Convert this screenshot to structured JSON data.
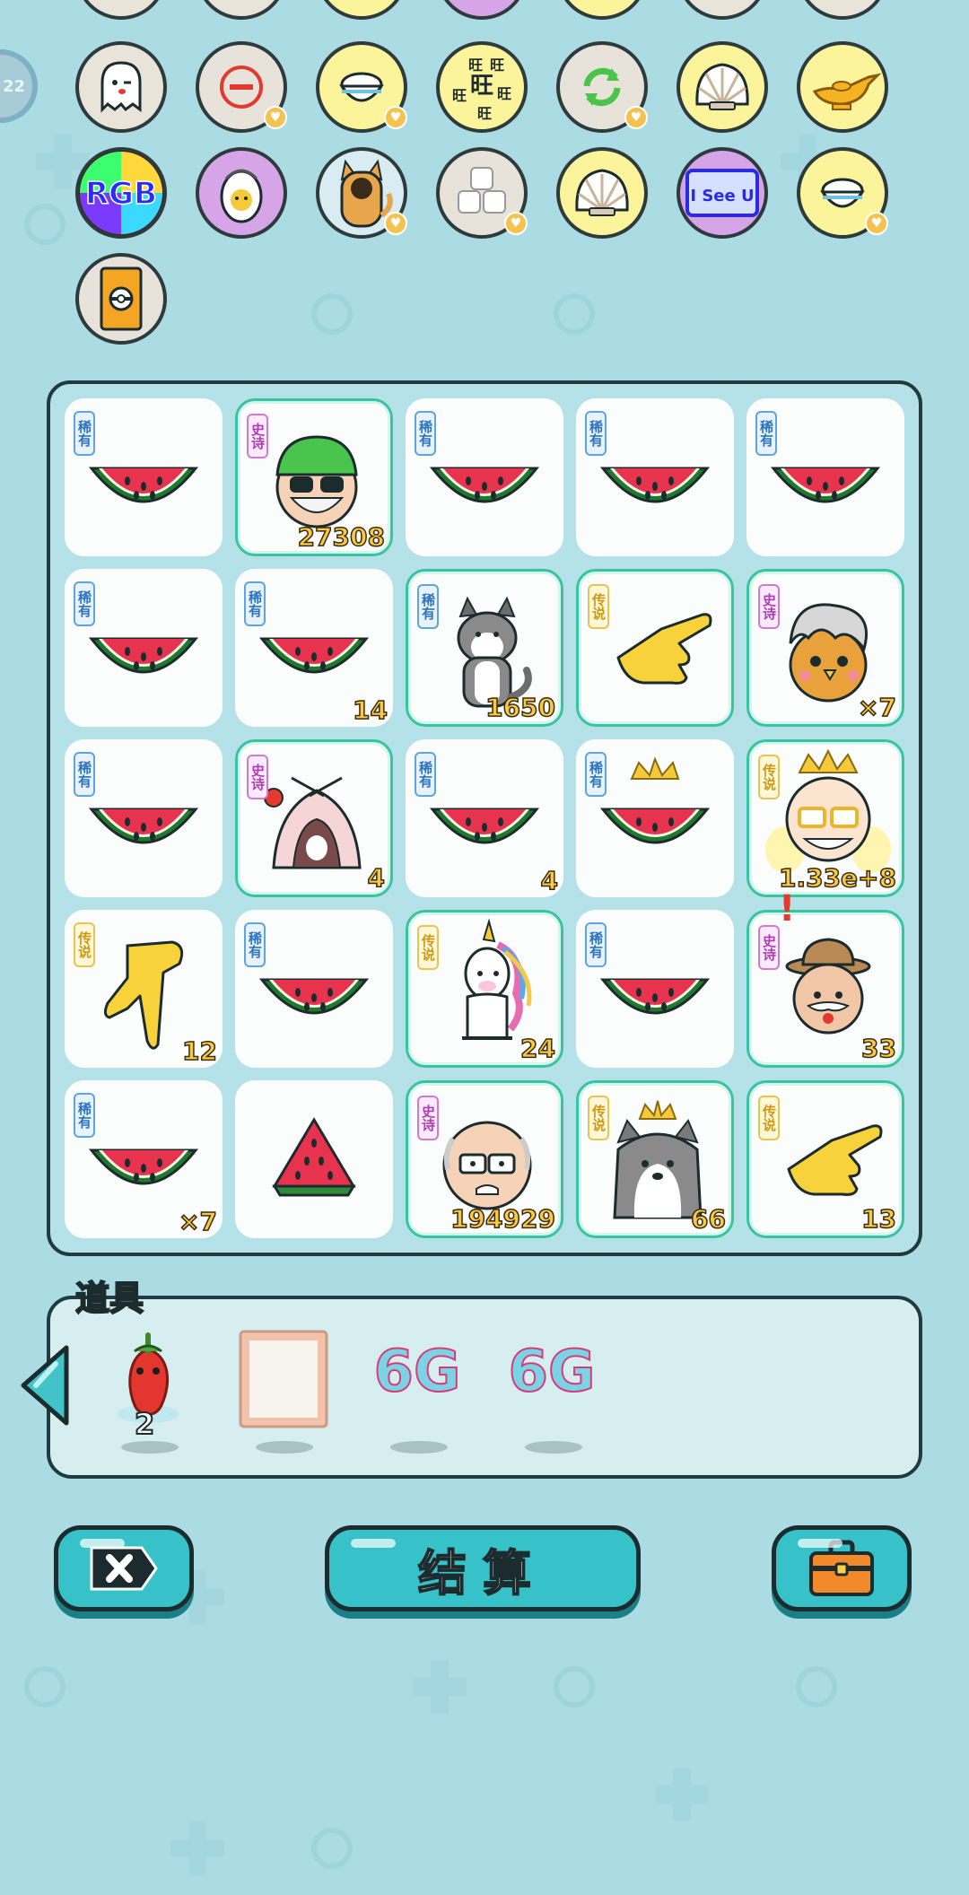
{
  "top_badges": {
    "level_text": "22",
    "row1": [
      {
        "name": "ghost",
        "bg": "#e9e4da"
      },
      {
        "name": "minus",
        "bg": "#e7e3da"
      },
      {
        "name": "rice-bowl",
        "bg": "#fbf49b"
      },
      {
        "name": "wang-text",
        "bg": "#fbf49b",
        "text": "旺"
      },
      {
        "name": "refresh",
        "bg": "#e7e3da"
      },
      {
        "name": "shell",
        "bg": "#fbf49b"
      },
      {
        "name": "magic-lamp",
        "bg": "#fbf49b"
      }
    ],
    "row2": [
      {
        "name": "rgb",
        "bg": "#2b2b2b",
        "text": "RGB"
      },
      {
        "name": "egg-face",
        "bg": "#d5a5e8"
      },
      {
        "name": "cat",
        "bg": "#d8ecf2"
      },
      {
        "name": "sugar-cubes",
        "bg": "#e7e3da"
      },
      {
        "name": "shell",
        "bg": "#fbf49b"
      },
      {
        "name": "i-see-u",
        "bg": "#d5a5e8",
        "text": "I See U"
      },
      {
        "name": "rice-bowl",
        "bg": "#fbf49b"
      }
    ],
    "row3": [
      {
        "name": "ticket",
        "bg": "#e7e3da"
      }
    ]
  },
  "grid": {
    "cells": [
      {
        "tag": "稀有",
        "tag_type": "rare",
        "item": "watermelon",
        "count": "",
        "hl": false
      },
      {
        "tag": "史诗",
        "tag_type": "epic",
        "item": "green-cap-man",
        "count": "27308",
        "hl": true
      },
      {
        "tag": "稀有",
        "tag_type": "rare",
        "item": "watermelon",
        "count": "",
        "hl": false
      },
      {
        "tag": "稀有",
        "tag_type": "rare",
        "item": "watermelon",
        "count": "",
        "hl": false
      },
      {
        "tag": "稀有",
        "tag_type": "rare",
        "item": "watermelon",
        "count": "",
        "hl": false
      },
      {
        "tag": "稀有",
        "tag_type": "rare",
        "item": "watermelon",
        "count": "",
        "hl": false
      },
      {
        "tag": "稀有",
        "tag_type": "rare",
        "item": "watermelon",
        "count": "14",
        "hl": false
      },
      {
        "tag": "稀有",
        "tag_type": "rare",
        "item": "husky",
        "count": "1650",
        "hl": true
      },
      {
        "tag": "传说",
        "tag_type": "legend",
        "item": "hand-point",
        "count": "",
        "hl": true
      },
      {
        "tag": "史诗",
        "tag_type": "epic",
        "item": "bird-grey-hair",
        "count": "×7",
        "hl": true
      },
      {
        "tag": "稀有",
        "tag_type": "rare",
        "item": "watermelon",
        "count": "",
        "hl": false
      },
      {
        "tag": "史诗",
        "tag_type": "epic",
        "item": "rabbit-tent",
        "count": "4",
        "hl": true
      },
      {
        "tag": "稀有",
        "tag_type": "rare",
        "item": "watermelon",
        "count": "4",
        "hl": false
      },
      {
        "tag": "稀有",
        "tag_type": "rare",
        "item": "watermelon-crown",
        "count": "",
        "hl": false
      },
      {
        "tag": "传说",
        "tag_type": "legend",
        "item": "king-grandpa",
        "count": "1.33e+8",
        "hl": true
      },
      {
        "tag": "传说",
        "tag_type": "legend",
        "item": "hand-down",
        "count": "12",
        "hl": false
      },
      {
        "tag": "稀有",
        "tag_type": "rare",
        "item": "watermelon",
        "count": "",
        "hl": false
      },
      {
        "tag": "传说",
        "tag_type": "legend",
        "item": "unicorn",
        "count": "24",
        "hl": true
      },
      {
        "tag": "稀有",
        "tag_type": "rare",
        "item": "watermelon",
        "count": "",
        "hl": false
      },
      {
        "tag": "史诗",
        "tag_type": "epic",
        "item": "hat-grandpa",
        "count": "33",
        "hl": true
      },
      {
        "tag": "稀有",
        "tag_type": "rare",
        "item": "watermelon",
        "count": "×7",
        "hl": false
      },
      {
        "tag": "",
        "tag_type": "",
        "item": "watermelon-slice",
        "count": "",
        "hl": false
      },
      {
        "tag": "史诗",
        "tag_type": "epic",
        "item": "bald-grandpa",
        "count": "194929",
        "hl": true
      },
      {
        "tag": "传说",
        "tag_type": "legend",
        "item": "husky-crown",
        "count": "66",
        "hl": true
      },
      {
        "tag": "传说",
        "tag_type": "legend",
        "item": "hand-point",
        "count": "13",
        "hl": true
      }
    ]
  },
  "props": {
    "title": "道具",
    "chili_count": "2",
    "items": [
      {
        "name": "chili"
      },
      {
        "name": "frame"
      },
      {
        "name": "6g-1",
        "label": "6G"
      },
      {
        "name": "6g-2",
        "label": "6G"
      }
    ]
  },
  "buttons": {
    "settle_label": "结算"
  },
  "colors": {
    "background": "#abdce4",
    "button": "#37c2ca",
    "rare": "#2c73c2",
    "epic": "#b13ab5",
    "legend": "#c99a14"
  }
}
